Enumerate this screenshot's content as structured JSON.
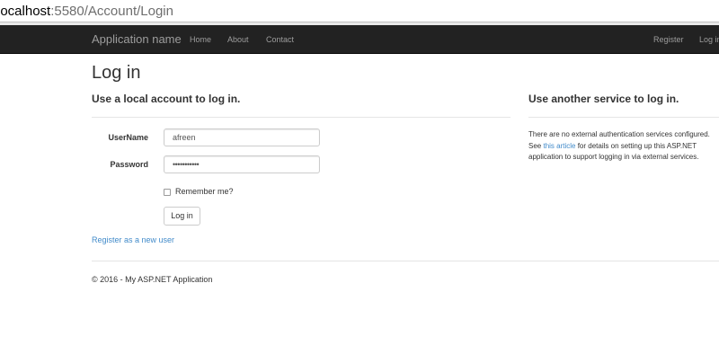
{
  "address_bar": {
    "host": "localhost",
    "path": ":5580/Account/Login"
  },
  "navbar": {
    "brand": "Application name",
    "links": [
      "Home",
      "About",
      "Contact"
    ],
    "right_links": [
      "Register",
      "Log in"
    ]
  },
  "page": {
    "title": "Log in",
    "local_heading": "Use a local account to log in.",
    "service_heading": "Use another service to log in."
  },
  "form": {
    "username_label": "UserName",
    "username_value": "afreen",
    "password_label": "Password",
    "password_value": "•••••••••••",
    "remember_label": "Remember me?",
    "remember_checked": false,
    "submit_label": "Log in",
    "register_link": "Register as a new user"
  },
  "external": {
    "line1": "There are no external authentication services configured.",
    "line2_prefix": "See ",
    "line2_link": "this article",
    "line2_suffix": " for details on setting up this ASP.NET",
    "line3": "application to support logging in via external services."
  },
  "footer": {
    "text": "© 2016 - My ASP.NET Application"
  },
  "colors": {
    "navbar_bg": "#222222",
    "navbar_text": "#9d9d9d",
    "link": "#428bca"
  }
}
